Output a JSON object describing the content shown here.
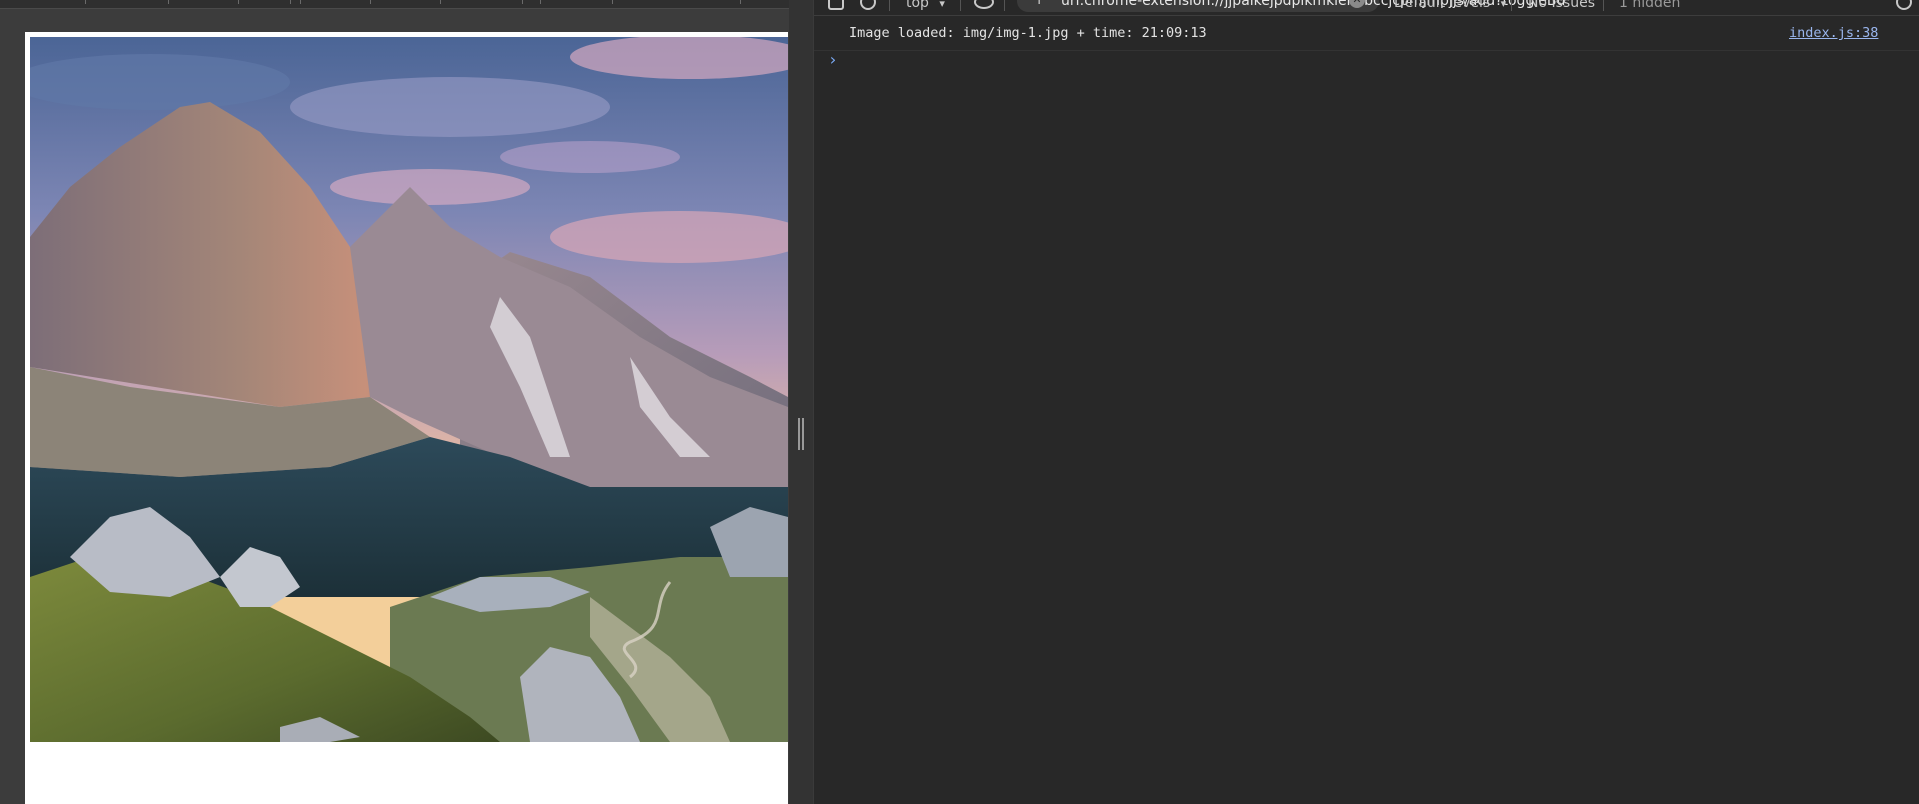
{
  "toolbar": {
    "context_label": "top",
    "context_caret": "▾",
    "filter_prefix": "f",
    "filter_value": "url:chrome-extension://jjpaikejpdpikmkienabccjcpmjmpjjs/add?toggleBu",
    "filter_clear": "✕",
    "levels_label": "Default levels",
    "levels_caret": "▾",
    "issues_label": "No Issues",
    "hidden_label": "1 hidden"
  },
  "console": {
    "messages": [
      {
        "text": "Image loaded: img/img-1.jpg + time: 21:09:13",
        "source": "index.js:38"
      }
    ],
    "prompt_symbol": "›"
  },
  "icons": {
    "toolbar": [
      "panel-toggle-icon",
      "clear-console-icon",
      "live-expression-eye-icon",
      "settings-gear-icon"
    ],
    "prompt": "chevron-right-icon"
  },
  "colors": {
    "devtools_bg": "#282828",
    "link": "#9ab6ee",
    "prompt": "#7cacf8",
    "page_bg": "#ffffff",
    "viewport_bg": "#3c3c3c"
  }
}
